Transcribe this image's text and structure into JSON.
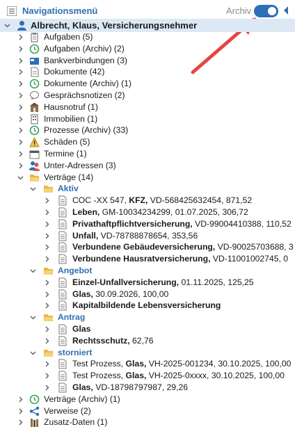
{
  "header": {
    "title": "Navigationsmenü",
    "archive_label": "Archiv",
    "archive_on": true
  },
  "root": {
    "label": "Albrecht, Klaus, Versicherungsnehmer"
  },
  "items": [
    {
      "icon": "clipboard-icon",
      "label": "Aufgaben (5)"
    },
    {
      "icon": "archive-clock-icon",
      "label": "Aufgaben (Archiv) (2)"
    },
    {
      "icon": "bank-card-icon",
      "label": "Bankverbindungen (3)"
    },
    {
      "icon": "document-icon",
      "label": "Dokumente (42)"
    },
    {
      "icon": "archive-clock-icon",
      "label": "Dokumente (Archiv) (1)"
    },
    {
      "icon": "speech-bubble-icon",
      "label": "Gesprächsnotizen (2)"
    },
    {
      "icon": "house-alarm-icon",
      "label": "Hausnotruf (1)"
    },
    {
      "icon": "building-icon",
      "label": "Immobilien (1)"
    },
    {
      "icon": "archive-clock-icon",
      "label": "Prozesse (Archiv) (33)"
    },
    {
      "icon": "warning-icon",
      "label": "Schäden (5)"
    },
    {
      "icon": "calendar-icon",
      "label": "Termine (1)"
    },
    {
      "icon": "people-icon",
      "label": "Unter-Adressen (3)"
    },
    {
      "icon": "folder-open-icon",
      "label": "Verträge (14)"
    }
  ],
  "contracts": {
    "groups": [
      {
        "label": "Aktiv",
        "entries": [
          {
            "pre": "COC -XX 547, ",
            "bold": "KFZ,",
            "post": " VD-568425632454, 871,52"
          },
          {
            "pre": "",
            "bold": "Leben,",
            "post": " GM-10034234299, 01.07.2025, 306,72"
          },
          {
            "pre": "",
            "bold": "Privathaftpflichtversicherung,",
            "post": " VD-99004410388, 110,52"
          },
          {
            "pre": "",
            "bold": "Unfall,",
            "post": " VD-78788878654, 353,56"
          },
          {
            "pre": "",
            "bold": "Verbundene Gebäudeversicherung,",
            "post": " VD-90025703688, 3"
          },
          {
            "pre": "",
            "bold": "Verbundene Hausratversicherung,",
            "post": " VD-11001002745, 0"
          }
        ]
      },
      {
        "label": "Angebot",
        "entries": [
          {
            "pre": "",
            "bold": "Einzel-Unfallversicherung,",
            "post": " 01.11.2025, 125,25"
          },
          {
            "pre": "",
            "bold": "Glas,",
            "post": " 30.09.2026, 100,00"
          },
          {
            "pre": "",
            "bold": "Kapitalbildende Lebensversicherung",
            "post": ""
          }
        ]
      },
      {
        "label": "Antrag",
        "entries": [
          {
            "pre": "",
            "bold": "Glas",
            "post": ""
          },
          {
            "pre": "",
            "bold": "Rechtsschutz,",
            "post": " 62,76"
          }
        ]
      },
      {
        "label": "storniert",
        "entries": [
          {
            "pre": "Test Prozess, ",
            "bold": "Glas,",
            "post": " VH-2025-001234, 30.10.2025, 100,00"
          },
          {
            "pre": "Test Prozess, ",
            "bold": "Glas,",
            "post": " VH-2025-0xxxx, 30.10.2025, 100,00"
          },
          {
            "pre": "",
            "bold": "Glas,",
            "post": " VD-18798797987, 29,26"
          }
        ]
      }
    ]
  },
  "tail_items": [
    {
      "icon": "archive-clock-icon",
      "label": "Verträge (Archiv) (1)"
    },
    {
      "icon": "share-icon",
      "label": "Verweise (2)"
    },
    {
      "icon": "books-icon",
      "label": "Zusatz-Daten (1)"
    }
  ],
  "colors": {
    "accent": "#2f6fb3",
    "toggle": "#2e6fb7",
    "highlight": "#dde8f5",
    "folder": "#f2c14e",
    "arrow": "#e64545"
  }
}
